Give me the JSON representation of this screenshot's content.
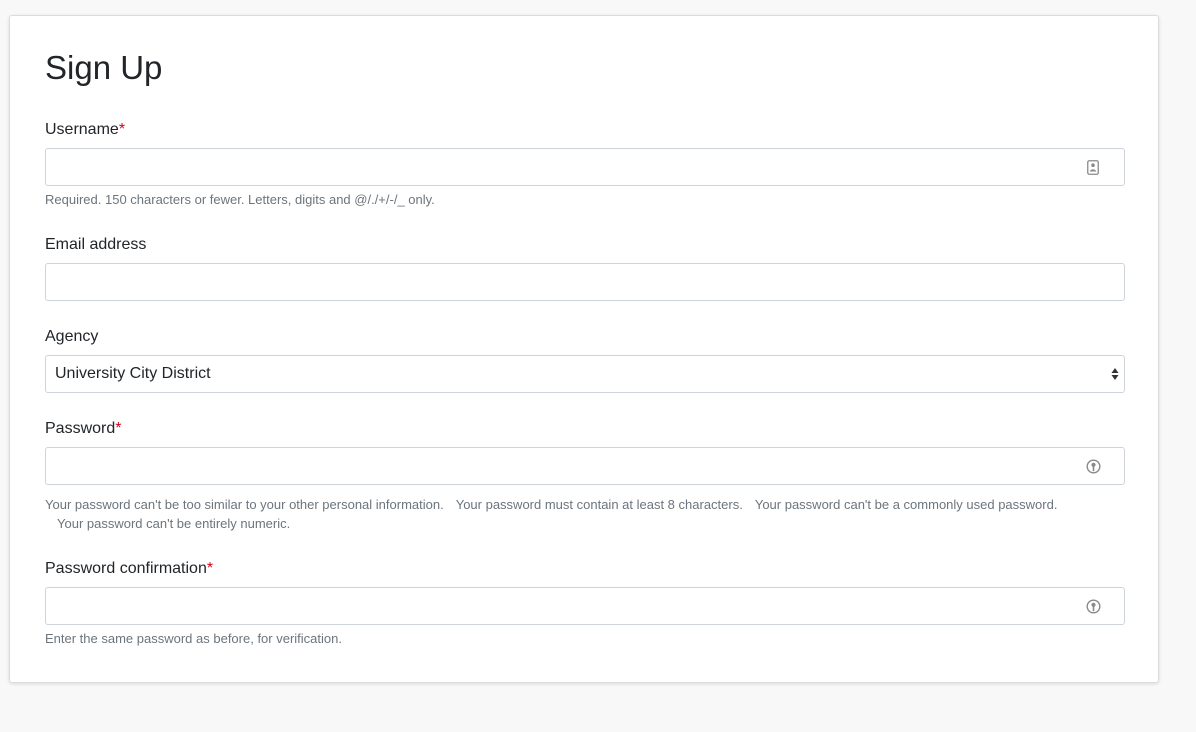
{
  "form": {
    "title": "Sign Up",
    "username": {
      "label": "Username",
      "required_mark": "*",
      "value": "",
      "placeholder": "",
      "help": "Required. 150 characters or fewer. Letters, digits and @/./+/-/_ only.",
      "icon": "contact-card-icon"
    },
    "email": {
      "label": "Email address",
      "value": "",
      "placeholder": ""
    },
    "agency": {
      "label": "Agency",
      "selected": "University City District"
    },
    "password": {
      "label": "Password",
      "required_mark": "*",
      "value": "",
      "placeholder": "",
      "icon": "password-key-icon",
      "help": [
        "Your password can't be too similar to your other personal information.",
        "Your password must contain at least 8 characters.",
        "Your password can't be a commonly used password.",
        "Your password can't be entirely numeric."
      ]
    },
    "password_confirmation": {
      "label": "Password confirmation",
      "required_mark": "*",
      "value": "",
      "placeholder": "",
      "icon": "password-key-icon",
      "help": "Enter the same password as before, for verification."
    }
  },
  "colors": {
    "required": "#d0021b",
    "help_text": "#6c757d",
    "border": "#ced4da",
    "page_background": "#f8f8f8"
  }
}
